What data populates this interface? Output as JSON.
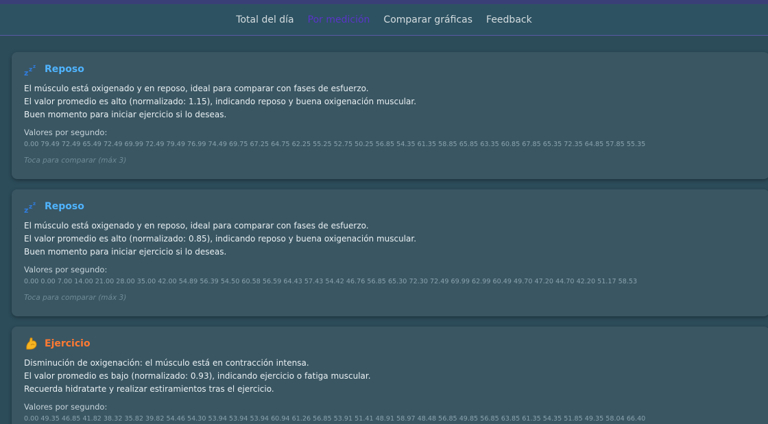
{
  "nav": {
    "items": [
      {
        "label": "Total del día"
      },
      {
        "label": "Por medición"
      },
      {
        "label": "Comparar gráficas"
      },
      {
        "label": "Feedback"
      }
    ]
  },
  "cards": [
    {
      "title": "Reposo",
      "icon": "sleep-zzz-icon",
      "line1": "El músculo está oxigenado y en reposo, ideal para comparar con fases de esfuerzo.",
      "line2": "El valor promedio es alto (normalizado: 1.15), indicando reposo y buena oxigenación muscular.",
      "line3": "Buen momento para iniciar ejercicio si lo deseas.",
      "values_label": "Valores por segundo:",
      "values": "0.00 79.49 72.49 65.49 72.49 69.99 72.49 79.49 76.99 74.49 69.75 67.25 64.75 62.25 55.25 52.75 50.25 56.85 54.35 61.35 58.85 65.85 63.35 60.85 67.85 65.35 72.35 64.85 57.85 55.35",
      "hint": "Toca para comparar (máx 3)"
    },
    {
      "title": "Reposo",
      "icon": "sleep-zzz-icon",
      "line1": "El músculo está oxigenado y en reposo, ideal para comparar con fases de esfuerzo.",
      "line2": "El valor promedio es alto (normalizado: 0.85), indicando reposo y buena oxigenación muscular.",
      "line3": "Buen momento para iniciar ejercicio si lo deseas.",
      "values_label": "Valores por segundo:",
      "values": "0.00 0.00 7.00 14.00 21.00 28.00 35.00 42.00 54.89 56.39 54.50 60.58 56.59 64.43 57.43 54.42 46.76 56.85 65.30 72.30 72.49 69.99 62.99 60.49 49.70 47.20 44.70 42.20 51.17 58.53",
      "hint": "Toca para comparar (máx 3)"
    },
    {
      "title": "Ejercicio",
      "icon": "flexed-biceps-icon",
      "line1": "Disminución de oxigenación: el músculo está en contracción intensa.",
      "line2": "El valor promedio es bajo (normalizado: 0.93), indicando ejercicio o fatiga muscular.",
      "line3": "Recuerda hidratarte y realizar estiramientos tras el ejercicio.",
      "values_label": "Valores por segundo:",
      "values": "0.00 49.35 46.85 41.82 38.32 35.82 39.82 54.46 54.30 53.94 53.94 53.94 60.94 61.26 56.85 53.91 51.41 48.91 58.97 48.48 56.85 49.85 56.85 63.85 61.35 54.35 51.85 49.35 58.04 66.40"
    }
  ],
  "colors": {
    "background": "#2c4c5a",
    "card": "#3a5663",
    "reposo_title": "#4fb4ff",
    "ejercicio_title": "#ff7a32",
    "nav_active": "#5a35c8"
  }
}
